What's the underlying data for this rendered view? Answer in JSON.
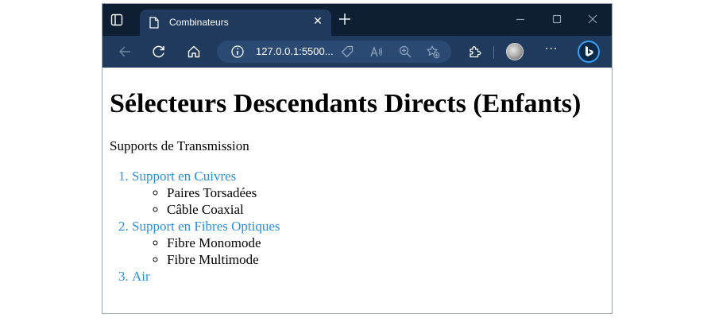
{
  "browser": {
    "tab_title": "Combinateurs",
    "url": "127.0.0.1:5500..."
  },
  "page": {
    "heading": "Sélecteurs Descendants Directs (Enfants)",
    "intro": "Supports de Transmission",
    "list": [
      {
        "label": "Support en Cuivres",
        "children": [
          "Paires Torsadées",
          "Câble Coaxial"
        ]
      },
      {
        "label": "Support en Fibres Optiques",
        "children": [
          "Fibre Monomode",
          "Fibre Multimode"
        ]
      },
      {
        "label": "Air",
        "children": []
      }
    ]
  },
  "colors": {
    "titlebar": "#0f1f33",
    "navbar": "#1f3a5c",
    "list_link": "#2a8fe8"
  },
  "icons": [
    "tab-actions-icon",
    "page-icon",
    "close-icon",
    "new-tab-icon",
    "minimize-icon",
    "maximize-icon",
    "window-close-icon",
    "back-icon",
    "refresh-icon",
    "home-icon",
    "info-icon",
    "tag-icon",
    "read-aloud-icon",
    "zoom-icon",
    "favorite-add-icon",
    "extensions-icon",
    "profile-avatar",
    "more-icon",
    "bing-icon"
  ]
}
